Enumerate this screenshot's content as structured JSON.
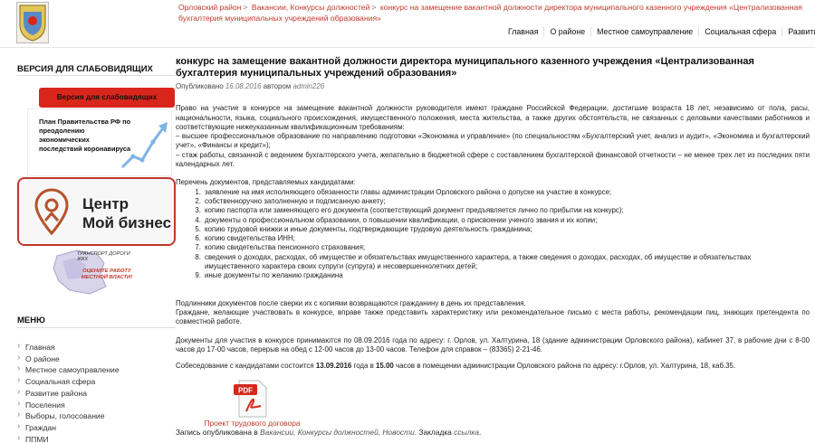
{
  "breadcrumb": {
    "items": [
      "Орловский район",
      "Вакансии, Конкурсы должностей",
      "конкурс на замещение вакантной должности директора муниципального казенного учреждения «Централизованная бухгалтерия муниципальных учреждений образования»"
    ],
    "sep": ">"
  },
  "topnav": [
    "Главная",
    "О районе",
    "Местное самоуправление",
    "Социальная сфера",
    "Развитие ра"
  ],
  "sidebar": {
    "title": "ВЕРСИЯ ДЛЯ СЛАБОВИДЯЩИХ",
    "vis_button": "Версия для слабовидящих",
    "banner1": "План Правительства РФ по преодолению экономических последствий коронавируса",
    "banner2": [
      "Центр",
      "Мой бизнес"
    ],
    "banner3": [
      "ТРАНСПОРТ ДОРОГИ ЖКХ",
      "ОЦЕНИТЕ РАБОТУ МЕСТНОЙ ВЛАСТИ!"
    ],
    "menu_title": "МЕНЮ",
    "menu": [
      "Главная",
      "О районе",
      "Местное самоуправление",
      "Социальная сфера",
      "Развитие района",
      "Поселения",
      "Выборы, голосование",
      "Граждан",
      "ППМИ"
    ]
  },
  "article": {
    "title": "конкурс на замещение вакантной должности директора муниципального казенного учреждения «Централизованная бухгалтерия муниципальных учреждений образования»",
    "posted_prefix": "Опубликовано",
    "date": "16.08.2016",
    "author_prefix": "автором",
    "author": "admin226",
    "p1": "Право на участие в конкурсе на замещение вакантной должности руководителя имеют граждане Российской Федерации, достигшие возраста 18 лет, независимо от пола, расы, национальности, языка, социального происхождения, имущественного положения, места жительства, а также других обстоятельств, не связанных с деловыми качествами работников и соответствующие нижеуказанным квалификационным требованиям:",
    "p2": "– высшее профессиональное образование по направлению подготовки «Экономика и управление» (по специальностям «Бухгалтерский учет, анализ и аудит», «Экономика и бухгалтерский учет», «Финансы и кредит»);",
    "p3": "– стаж работы, связанной с ведением бухгалтерского учета, желательно в бюджетной сфере с составлением бухгалтерской финансовой отчетности – не менее трех лет из последних пяти календарных лет.",
    "list_intro": "Перечень документов, представляемых кандидатами:",
    "list": [
      "заявление на имя исполняющего обязанности главы администрации Орловского района о допуске на участие в конкурсе;",
      "собственноручно заполненную и подписанную анкету;",
      "копию паспорта или заменяющего его документа (соответствующий документ предъявляется лично по прибытии на конкурс);",
      "документы о профессиональном образовании, о повышении квалификации, о присвоении ученого звания и их копии;",
      "копию трудовой книжки и иные документы, подтверждающие трудовую деятельность гражданина;",
      "копию свидетельства ИНН;",
      "копию свидетельства пенсионного страхования;",
      "сведения о доходах, расходах, об имуществе и обязательствах имущественного характера, а также сведения о доходах, расходах, об имуществе и обязательствах имущественного характера своих супруги (супруга) и несовершеннолетних детей;",
      "иные документы по желанию гражданина"
    ],
    "p4": "Подлинники документов после сверки их с копиями возвращаются гражданину в день их представления.",
    "p5": "Граждане, желающие участвовать в конкурсе, вправе также представить характеристику или рекомендательное письмо с места работы, рекомендации лиц, знающих претендента по совместной работе.",
    "p6": "Документы для участия в конкурсе принимаются по 08.09.2016 года по адресу: г. Орлов, ул. Халтурина, 18 (здание администрации Орловского района), кабинет 37, в рабочие дни с 8-00 часов до 17-00 часов, перерыв на обед с 12-00 часов до 13-00 часов. Телефон для справок – (83365) 2-21-46.",
    "p7_a": "Собеседование с кандидатами состоится",
    "p7_date": "13.09.2016",
    "p7_b": "года в",
    "p7_time": "15.00",
    "p7_c": "часов в помещении администрации Орловского района по адресу: г.Орлов, ул. Халтурина, 18, каб.35.",
    "pdf_label": "PDF",
    "pdf_link": "Проект трудового договора",
    "record_prefix": "Запись опубликована в",
    "record_cats": "Вакансии, Конкурсы должностей, Новости",
    "record_mid": ". Закладка",
    "record_link": "ссылка",
    "record_end": "."
  }
}
